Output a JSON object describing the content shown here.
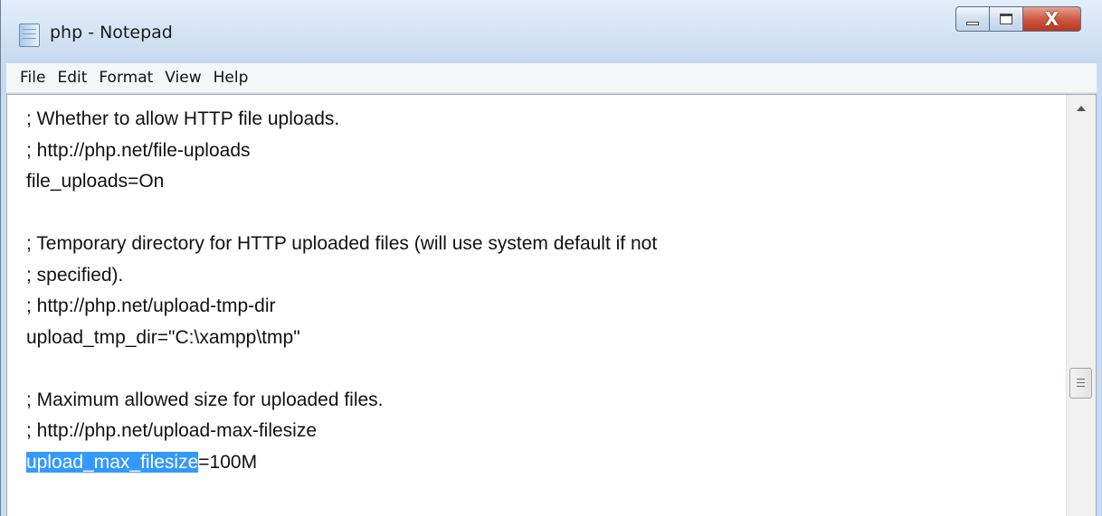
{
  "window": {
    "title": "php - Notepad",
    "icon": "notepad-icon",
    "controls": {
      "minimize": "minimize-icon",
      "maximize": "maximize-icon",
      "close_glyph": "X"
    }
  },
  "menu": [
    "File",
    "Edit",
    "Format",
    "View",
    "Help"
  ],
  "editor": {
    "lines": [
      "; Whether to allow HTTP file uploads.",
      "; http://php.net/file-uploads",
      "file_uploads=On",
      "",
      "; Temporary directory for HTTP uploaded files (will use system default if not",
      "; specified).",
      "; http://php.net/upload-tmp-dir",
      "upload_tmp_dir=\"C:\\xampp\\tmp\"",
      "",
      "; Maximum allowed size for uploaded files.",
      "; http://php.net/upload-max-filesize"
    ],
    "selected_line": {
      "selected": "upload_max_filesize",
      "rest": "=100M"
    }
  },
  "colors": {
    "selection": "#3399ff",
    "titlebar": "#d6e5f6",
    "close_button": "#cf5a43"
  }
}
